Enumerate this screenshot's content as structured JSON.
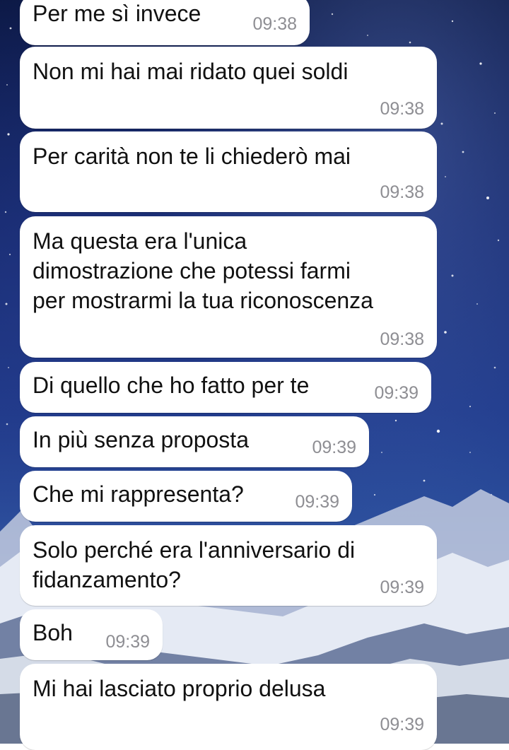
{
  "wallpaper": {
    "description_icon": "starry-night-mountain-wallpaper"
  },
  "colors": {
    "bubble": "#ffffff",
    "text": "#111111",
    "timestamp": "#8e8e93",
    "sky_top": "#0b1742",
    "sky_mid": "#1f3a8a"
  },
  "messages": [
    {
      "text": "Per me sì invece",
      "time": "09:38"
    },
    {
      "text": "Non mi hai mai ridato quei soldi",
      "time": "09:38"
    },
    {
      "text": "Per carità non te li chiederò mai",
      "time": "09:38"
    },
    {
      "text": "Ma questa era l'unica\ndimostrazione che potessi farmi\nper mostrarmi la tua riconoscenza",
      "time": "09:38"
    },
    {
      "text": "Di quello che ho fatto per te",
      "time": "09:39"
    },
    {
      "text": "In più senza proposta",
      "time": "09:39"
    },
    {
      "text": "Che mi rappresenta?",
      "time": "09:39"
    },
    {
      "text": "Solo perché era l'anniversario di\nfidanzamento?",
      "time": "09:39"
    },
    {
      "text": "Boh",
      "time": "09:39"
    },
    {
      "text": "Mi hai lasciato proprio delusa",
      "time": "09:39"
    }
  ]
}
